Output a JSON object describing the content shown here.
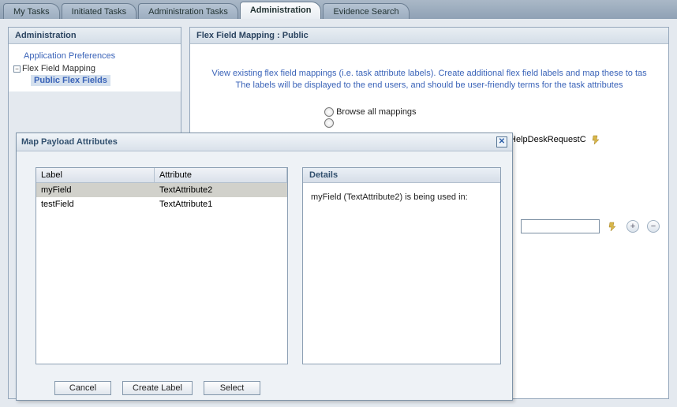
{
  "tabs": {
    "my_tasks": "My Tasks",
    "initiated": "Initiated Tasks",
    "admin_tasks": "Administration Tasks",
    "administration": "Administration",
    "evidence": "Evidence Search"
  },
  "left_panel": {
    "title": "Administration",
    "app_prefs": "Application Preferences",
    "flex_mapping": "Flex Field Mapping",
    "public_flex": "Public Flex Fields"
  },
  "right_panel": {
    "title": "Flex Field Mapping : Public",
    "desc_line1": "View existing flex field mappings (i.e. task attribute labels). Create additional flex field labels and map these to tas",
    "desc_line2": "The labels will be displayed to the end users, and should be user-friendly terms for the task attributes",
    "browse_label": "Browse all mappings",
    "task_path": "uestSCAApp/HelpDeskRequestC"
  },
  "modal": {
    "title": "Map Payload Attributes",
    "col_label": "Label",
    "col_attr": "Attribute",
    "rows": [
      {
        "label": "myField",
        "attr": "TextAttribute2"
      },
      {
        "label": "testField",
        "attr": "TextAttribute1"
      }
    ],
    "details_title": "Details",
    "details_body": "myField (TextAttribute2) is being used in:",
    "btn_cancel": "Cancel",
    "btn_create": "Create Label",
    "btn_select": "Select"
  },
  "icons": {
    "minus": "−",
    "plus": "+",
    "close": "✕"
  }
}
